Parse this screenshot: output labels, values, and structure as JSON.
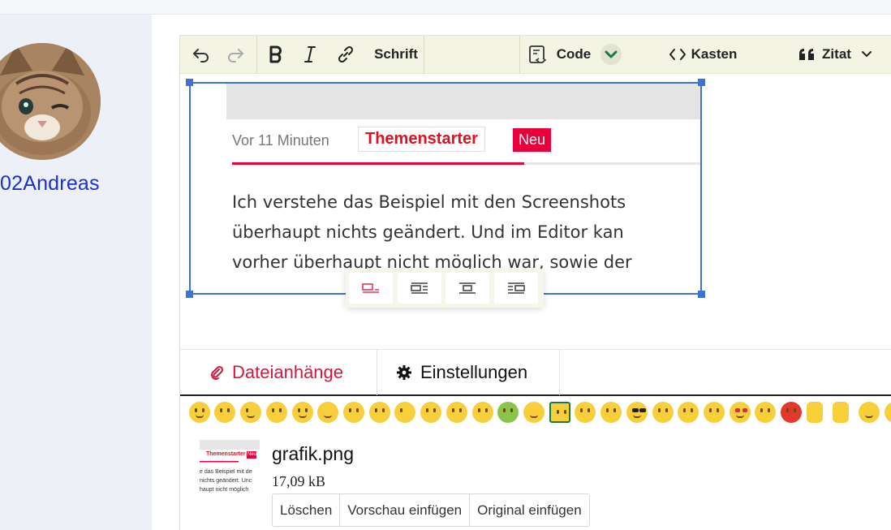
{
  "user": {
    "name": "02Andreas"
  },
  "toolbar": {
    "undo_icon": "undo-icon",
    "redo_icon": "redo-icon",
    "bold_icon": "bold-icon",
    "italic_icon": "italic-icon",
    "link_icon": "link-icon",
    "font_label": "Schrift",
    "code_label": "Code",
    "box_label": "Kasten",
    "quote_label": "Zitat"
  },
  "embedded_image": {
    "time": "Vor 11 Minuten",
    "starter_badge": "Themenstarter",
    "new_badge": "Neu",
    "lines": [
      "Ich verstehe das Beispiel mit den Screenshots",
      "überhaupt nichts geändert. Und im Editor kan",
      "vorher überhaupt nicht möglich war, sowie der"
    ]
  },
  "tabs": {
    "attachments": "Dateianhänge",
    "settings": "Einstellungen"
  },
  "attachment": {
    "filename": "grafik.png",
    "size": "17,09 kB",
    "thumb_badge": "Themenstarter",
    "thumb_new": "Neu",
    "thumb_lines": [
      "e das Beispiel mit de",
      "nichts geändert. Unc",
      "haupt nicht möglich"
    ],
    "buttons": {
      "delete": "Löschen",
      "insert_preview": "Vorschau einfügen",
      "insert_original": "Original einfügen"
    }
  },
  "colors": {
    "accent_red": "#d6153b",
    "link_blue": "#1a2fd4",
    "selection_blue": "#3a73d4",
    "toolbar_bg": "#f3f4e3"
  }
}
